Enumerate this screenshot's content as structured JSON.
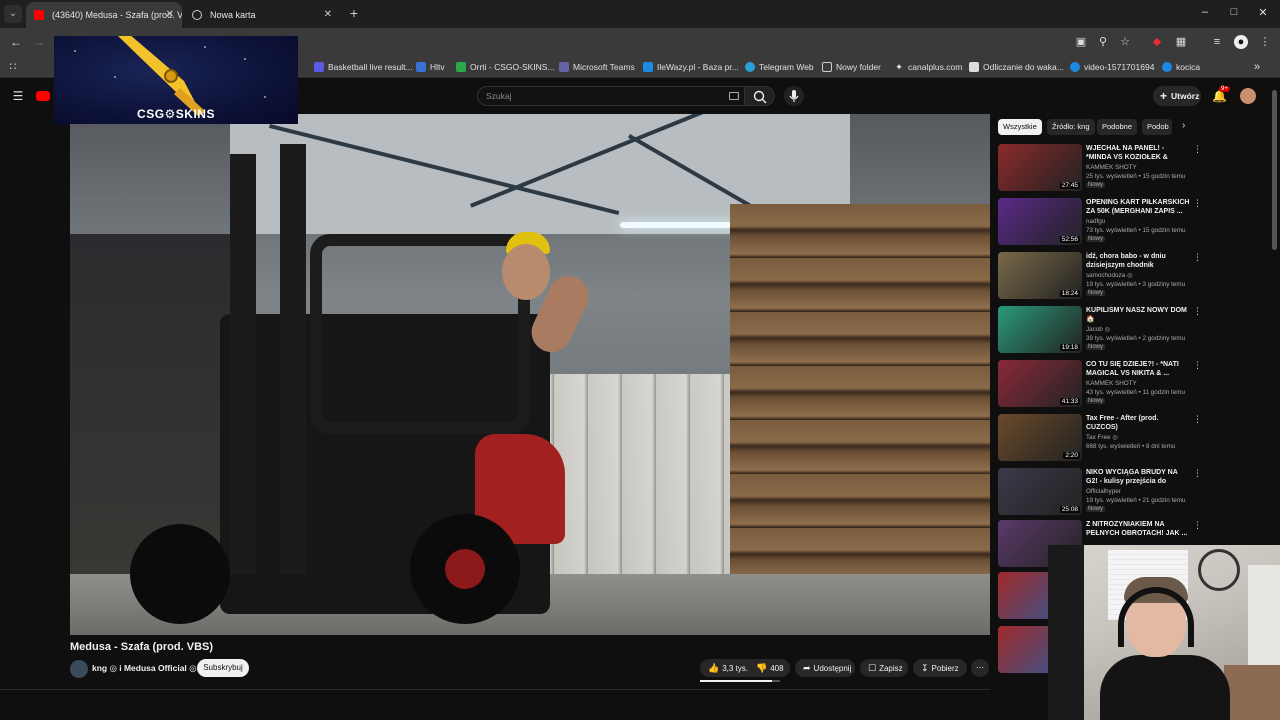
{
  "browser": {
    "tabs": [
      {
        "label": "(43640) Medusa - Szafa (prod. V",
        "active": true
      },
      {
        "label": "Nowa karta",
        "active": false
      }
    ],
    "new_tab": "+",
    "window_controls": [
      "–",
      "□",
      "✕"
    ],
    "bookmarks": [
      {
        "label": "Basketball live result...",
        "color": "#5a5ae6"
      },
      {
        "label": "Hltv",
        "color": "#3a6fd6"
      },
      {
        "label": "Orrti - CSGO-SKINS...",
        "color": "#2aa84a"
      },
      {
        "label": "Microsoft Teams",
        "color": "#6264a7"
      },
      {
        "label": "IleWazy.pl - Baza pr...",
        "color": "#1e88e5"
      },
      {
        "label": "Telegram Web",
        "color": "#2aa0d8"
      },
      {
        "label": "Nowy folder",
        "color": "#cccccc"
      },
      {
        "label": "canalplus.com",
        "color": "#eeeeee"
      },
      {
        "label": "Odliczanie do waka...",
        "color": "#dddddd"
      },
      {
        "label": "video-1571701694",
        "color": "#1e88e5"
      },
      {
        "label": "kocica",
        "color": "#1e88e5"
      }
    ]
  },
  "overlay": {
    "brand": "CSG⚙SKINS"
  },
  "youtube": {
    "search_placeholder": "Szukaj",
    "create_label": "Utwórz",
    "notifications_badge": "9+"
  },
  "video": {
    "title": "Medusa - Szafa (prod. VBS)",
    "channel": "kng ◎ i Medusa Official ◎",
    "subscribe_label": "Subskrybuj",
    "likes": "3,3 tys.",
    "dislikes": "408",
    "share_label": "Udostępnij",
    "save_label": "Zapisz",
    "download_label": "Pobierz",
    "more_label": "⋯"
  },
  "sidebar": {
    "chips": [
      "Wszystkie",
      "Źródło: kng",
      "Podobne",
      "Podob"
    ],
    "recommendations": [
      {
        "title": "WJECHAŁ NA PANEL! - *MINDA VS KOZIOŁEK & SEQUENTO* ...",
        "channel": "KAMMEK SHOTY",
        "meta": "25 tys. wyświetleń • 15 godzin temu",
        "badge": "Nowy",
        "duration": "27:45",
        "color": "#8a2a2a"
      },
      {
        "title": "OPENING KART PIŁKARSKICH ZA 50K (MERGHANI ZAPIS ...",
        "channel": "nadfgu",
        "meta": "73 tys. wyświetleń • 15 godzin temu",
        "badge": "Nowy",
        "duration": "52:56",
        "color": "#5b2a8a"
      },
      {
        "title": "idź, chora babo - w dniu dzisiejszym chodnik nieczynn...",
        "channel": "samochodoza ◎",
        "meta": "19 tys. wyświetleń • 3 godziny temu",
        "badge": "Nowy",
        "duration": "18:24",
        "color": "#7a6a4a"
      },
      {
        "title": "KUPILIŚMY NASZ NOWY DOM 🏠",
        "channel": "Jacob ◎",
        "meta": "39 tys. wyświetleń • 2 godziny temu",
        "badge": "Nowy",
        "duration": "19:18",
        "color": "#2a9a7a"
      },
      {
        "title": "CO TU SIĘ DZIEJE?! - *NATI MAGICAL VS NIKITA & ...",
        "channel": "KAMMEK SHOTY",
        "meta": "43 tys. wyświetleń • 11 godzin temu",
        "badge": "Nowy",
        "duration": "41:33",
        "color": "#8a2a3a"
      },
      {
        "title": "Tax Free - After (prod. CUZCOS)",
        "channel": "Tax Free ◎",
        "meta": "668 tys. wyświetleń • 8 dni temu",
        "badge": "",
        "duration": "2:20",
        "color": "#6a4a2a"
      },
      {
        "title": "NIKO WYCIĄGA BRUDY NA G2! - kulisy przejścia do Falcons",
        "channel": "Officialhyper",
        "meta": "19 tys. wyświetleń • 21 godzin temu",
        "badge": "Nowy",
        "duration": "25:08",
        "color": "#3a3a4a"
      },
      {
        "title": "Z NITROZYNIAKIEM NA PEŁNYCH OBROTACH! JAK ...",
        "channel": "",
        "meta": "",
        "badge": "",
        "duration": "",
        "color": "#5a3a6a"
      }
    ]
  }
}
